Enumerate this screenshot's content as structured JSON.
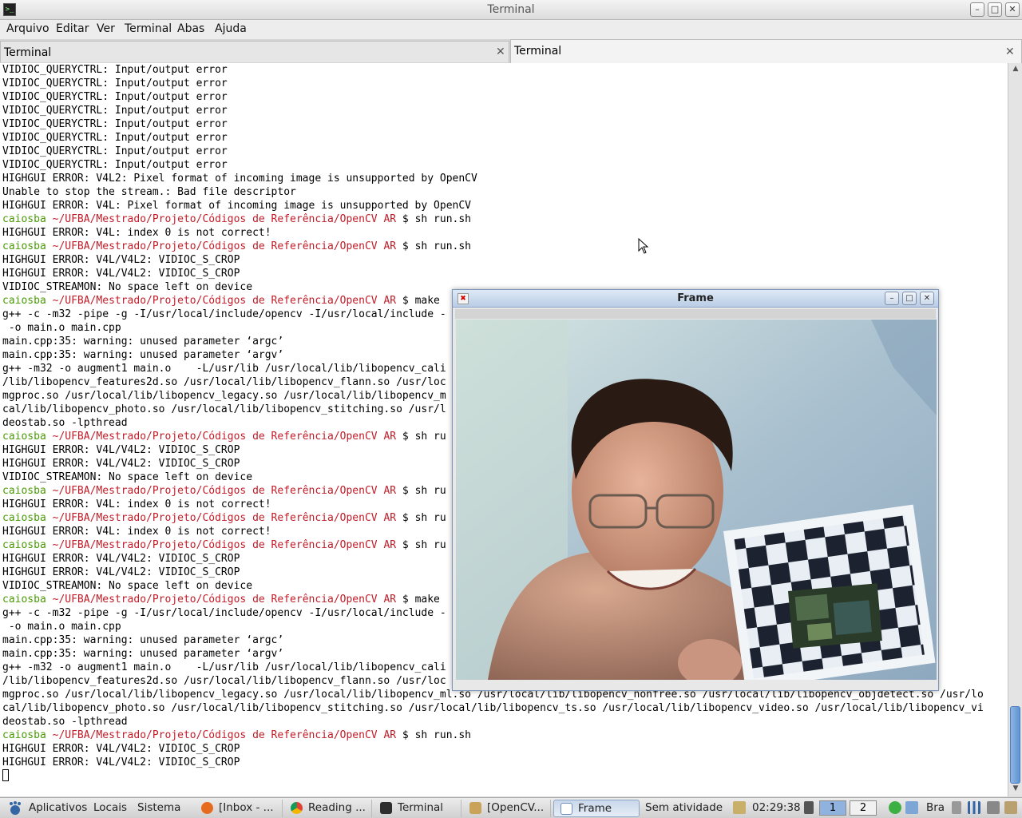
{
  "window": {
    "title": "Terminal"
  },
  "menubar": {
    "items": [
      "Arquivo",
      "Editar",
      "Ver",
      "Terminal",
      "Abas",
      "Ajuda"
    ]
  },
  "tabs": [
    {
      "label": "Terminal",
      "active": false
    },
    {
      "label": "Terminal",
      "active": true
    }
  ],
  "terminal": {
    "lines": [
      "VIDIOC_QUERYCTRL: Input/output error",
      "VIDIOC_QUERYCTRL: Input/output error",
      "VIDIOC_QUERYCTRL: Input/output error",
      "VIDIOC_QUERYCTRL: Input/output error",
      "VIDIOC_QUERYCTRL: Input/output error",
      "VIDIOC_QUERYCTRL: Input/output error",
      "VIDIOC_QUERYCTRL: Input/output error",
      "VIDIOC_QUERYCTRL: Input/output error",
      "HIGHGUI ERROR: V4L2: Pixel format of incoming image is unsupported by OpenCV",
      "Unable to stop the stream.: Bad file descriptor",
      "HIGHGUI ERROR: V4L: Pixel format of incoming image is unsupported by OpenCV",
      {
        "user": "caiosba",
        "path": "~/UFBA/Mestrado/Projeto/Códigos de Referência/OpenCV AR",
        "cmd": " $ sh run.sh"
      },
      "HIGHGUI ERROR: V4L: index 0 is not correct!",
      {
        "user": "caiosba",
        "path": "~/UFBA/Mestrado/Projeto/Códigos de Referência/OpenCV AR",
        "cmd": " $ sh run.sh"
      },
      "HIGHGUI ERROR: V4L/V4L2: VIDIOC_S_CROP",
      "HIGHGUI ERROR: V4L/V4L2: VIDIOC_S_CROP",
      "VIDIOC_STREAMON: No space left on device",
      {
        "user": "caiosba",
        "path": "~/UFBA/Mestrado/Projeto/Códigos de Referência/OpenCV AR",
        "cmd": " $ make"
      },
      "g++ -c -m32 -pipe -g -I/usr/local/include/opencv -I/usr/local/include -                                                 ude/qt4 -I.",
      " -o main.o main.cpp",
      "main.cpp:35: warning: unused parameter ‘argc’",
      "main.cpp:35: warning: unused parameter ‘argv’",
      "g++ -m32 -o augment1 main.o    -L/usr/lib /usr/local/lib/libopencv_cali                                                 /usr/local",
      "/lib/libopencv_features2d.so /usr/local/lib/libopencv_flann.so /usr/loc                                                 ibopencv_i",
      "mgproc.so /usr/local/lib/libopencv_legacy.so /usr/local/lib/libopencv_m                                                 so /usr/lo",
      "cal/lib/libopencv_photo.so /usr/local/lib/libopencv_stitching.so /usr/l                                                 bopencv_vi",
      "deostab.so -lpthread",
      {
        "user": "caiosba",
        "path": "~/UFBA/Mestrado/Projeto/Códigos de Referência/OpenCV AR",
        "cmd": " $ sh ru"
      },
      "HIGHGUI ERROR: V4L/V4L2: VIDIOC_S_CROP",
      "HIGHGUI ERROR: V4L/V4L2: VIDIOC_S_CROP",
      "VIDIOC_STREAMON: No space left on device",
      {
        "user": "caiosba",
        "path": "~/UFBA/Mestrado/Projeto/Códigos de Referência/OpenCV AR",
        "cmd": " $ sh ru"
      },
      "HIGHGUI ERROR: V4L: index 0 is not correct!",
      {
        "user": "caiosba",
        "path": "~/UFBA/Mestrado/Projeto/Códigos de Referência/OpenCV AR",
        "cmd": " $ sh ru"
      },
      "HIGHGUI ERROR: V4L: index 0 is not correct!",
      {
        "user": "caiosba",
        "path": "~/UFBA/Mestrado/Projeto/Códigos de Referência/OpenCV AR",
        "cmd": " $ sh ru"
      },
      "HIGHGUI ERROR: V4L/V4L2: VIDIOC_S_CROP",
      "HIGHGUI ERROR: V4L/V4L2: VIDIOC_S_CROP",
      "VIDIOC_STREAMON: No space left on device",
      {
        "user": "caiosba",
        "path": "~/UFBA/Mestrado/Projeto/Códigos de Referência/OpenCV AR",
        "cmd": " $ make"
      },
      "g++ -c -m32 -pipe -g -I/usr/local/include/opencv -I/usr/local/include -                                                 ude/qt4 -I.",
      " -o main.o main.cpp",
      "main.cpp:35: warning: unused parameter ‘argc’",
      "main.cpp:35: warning: unused parameter ‘argv’",
      "g++ -m32 -o augment1 main.o    -L/usr/lib /usr/local/lib/libopencv_cali                                                 /usr/local",
      "/lib/libopencv_features2d.so /usr/local/lib/libopencv_flann.so /usr/loc                                                 ibopencv_i",
      "mgproc.so /usr/local/lib/libopencv_legacy.so /usr/local/lib/libopencv_ml.so /usr/local/lib/libopencv_nonfree.so /usr/local/lib/libopencv_objdetect.so /usr/lo",
      "cal/lib/libopencv_photo.so /usr/local/lib/libopencv_stitching.so /usr/local/lib/libopencv_ts.so /usr/local/lib/libopencv_video.so /usr/local/lib/libopencv_vi",
      "deostab.so -lpthread",
      {
        "user": "caiosba",
        "path": "~/UFBA/Mestrado/Projeto/Códigos de Referência/OpenCV AR",
        "cmd": " $ sh run.sh"
      },
      "HIGHGUI ERROR: V4L/V4L2: VIDIOC_S_CROP",
      "HIGHGUI ERROR: V4L/V4L2: VIDIOC_S_CROP",
      ""
    ],
    "colors": {
      "user": "#4a9a06",
      "path": "#c01c28",
      "text": "#000000",
      "background": "#ffffff"
    }
  },
  "frame_window": {
    "title": "Frame",
    "content": "webcam image of a smiling person with glasses holding a checkerboard marker with an augmented image overlay"
  },
  "taskbar": {
    "menus": [
      "Aplicativos",
      "Locais",
      "Sistema"
    ],
    "tasks": [
      {
        "label": "[Inbox - ...",
        "icon": "firefox-icon",
        "active": false
      },
      {
        "label": "Reading ...",
        "icon": "chrome-icon",
        "active": false
      },
      {
        "label": "Terminal",
        "icon": "terminal-icon",
        "active": false
      },
      {
        "label": "[OpenCV...",
        "icon": "folder-icon",
        "active": false
      },
      {
        "label": "Frame",
        "icon": "window-icon",
        "active": true
      }
    ],
    "status": "Sem atividade",
    "clock": "02:29:38",
    "workspaces": [
      "1",
      "2"
    ],
    "keyboard_layout": "Bra"
  }
}
